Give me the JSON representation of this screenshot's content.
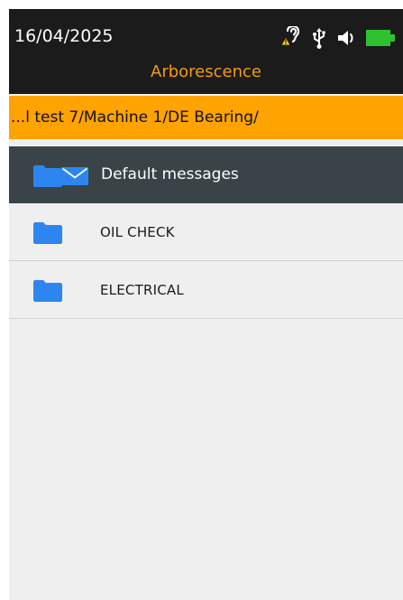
{
  "status_bar": {
    "date": "16/04/2025",
    "icons": [
      "hearing-warning-icon",
      "usb-icon",
      "speaker-icon",
      "battery-icon"
    ]
  },
  "app": {
    "title": "Arborescence"
  },
  "path_bar": {
    "text": "...l test 7/Machine 1/DE Bearing/"
  },
  "folder_header": {
    "label": "Default messages",
    "icons": [
      "folder-icon",
      "envelope-icon"
    ]
  },
  "list": {
    "items": [
      {
        "label": "OIL CHECK",
        "icon": "folder-icon"
      },
      {
        "label": "ELECTRICAL",
        "icon": "folder-icon"
      }
    ]
  },
  "colors": {
    "status_bar_bg": "#1b1b1b",
    "title_accent": "#f39a16",
    "path_bar_bg": "#ffa300",
    "header_bg": "#3a4348",
    "folder_blue": "#2d86f0",
    "battery_green": "#2fc12f",
    "list_bg": "#efefef"
  }
}
